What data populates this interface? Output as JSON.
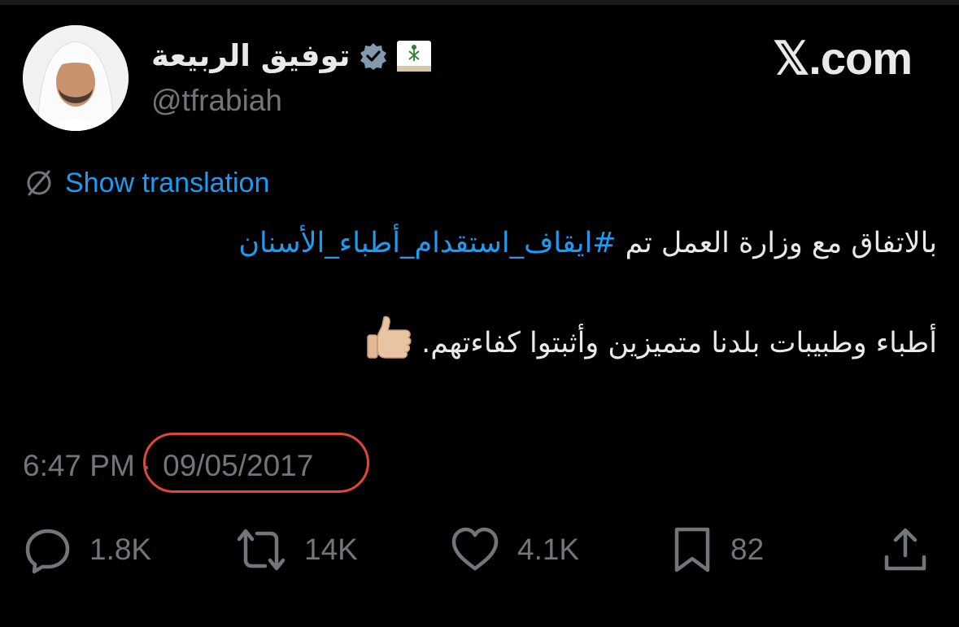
{
  "profile": {
    "display_name": "توفيق الربيعة",
    "handle": "@tfrabiah"
  },
  "brand": "𝕏.com",
  "translation": {
    "label": "Show translation"
  },
  "tweet": {
    "line1_prefix": "بالاتفاق مع وزارة العمل تم ",
    "hashtag": "#ايقاف_استقدام_أطباء_الأسنان",
    "line2": "أطباء وطبيبات بلدنا متميزين وأثبتوا كفاءتهم."
  },
  "meta": {
    "time": "6:47 PM",
    "separator": "·",
    "date": "09/05/2017"
  },
  "actions": {
    "replies": "1.8K",
    "reposts": "14K",
    "likes": "4.1K",
    "bookmarks": "82"
  },
  "colors": {
    "accent": "#1d9bf0",
    "muted": "#71767b",
    "highlight_circle": "#e0463c"
  }
}
